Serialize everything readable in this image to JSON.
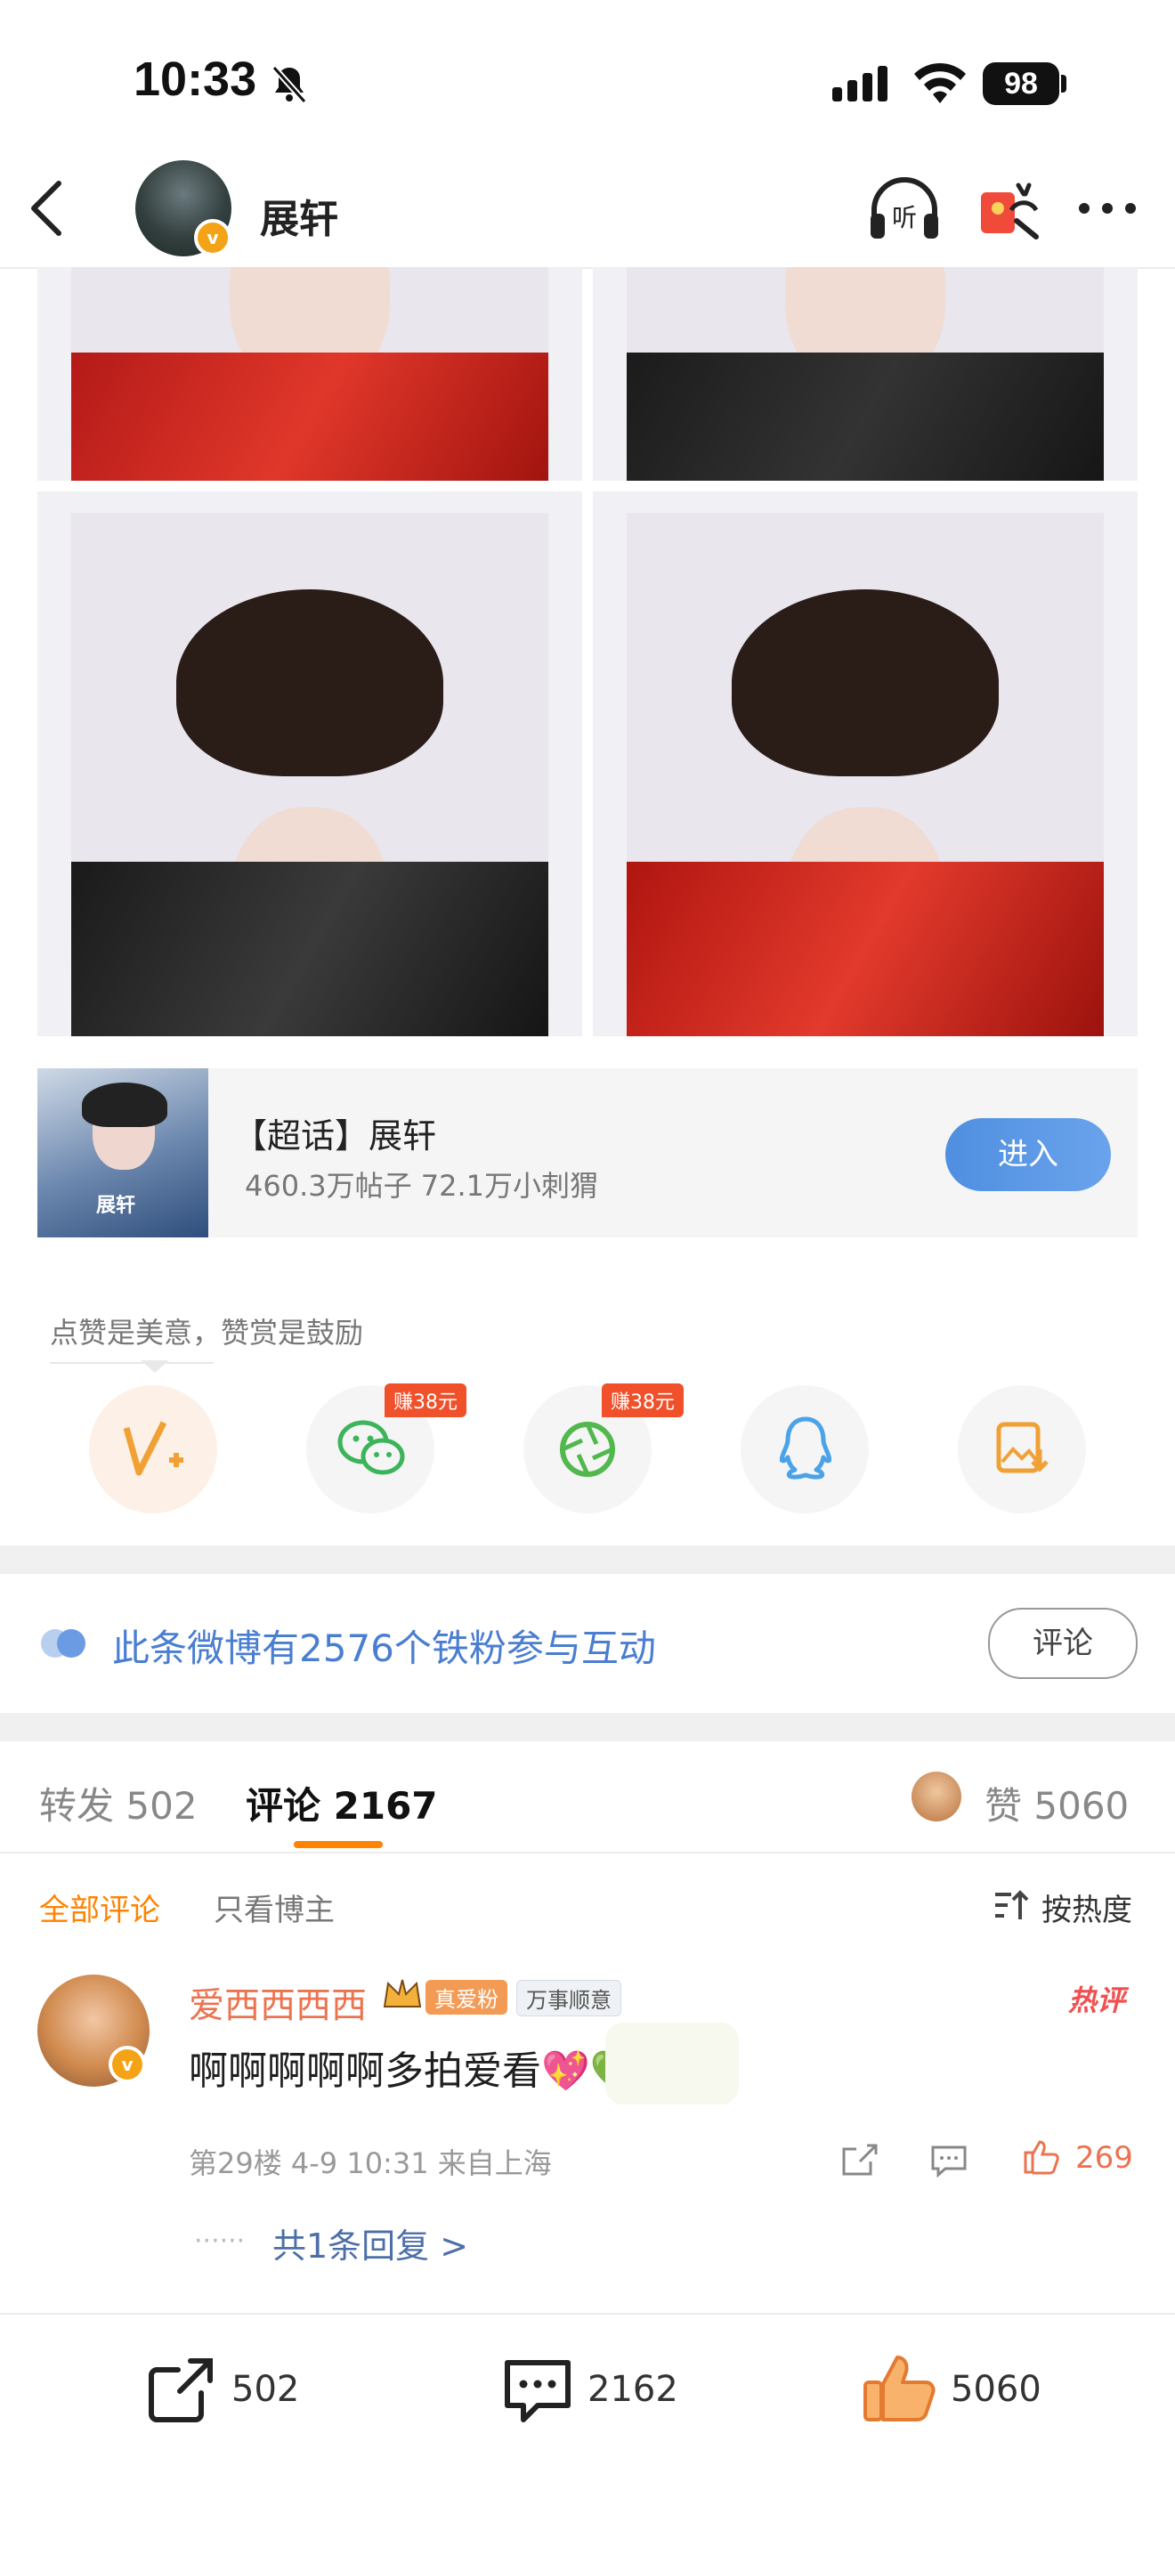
{
  "status_bar": {
    "time": "10:33",
    "battery": "98"
  },
  "header": {
    "user_name": "展轩"
  },
  "super_topic": {
    "title": "【超话】展轩",
    "stats": "460.3万帖子 72.1万小刺猬",
    "enter_label": "进入",
    "thumb_name": "展轩"
  },
  "reward_tip": "点赞是美意，赞赏是鼓励",
  "share": {
    "reward_tag_1": "赚38元",
    "reward_tag_2": "赚38元"
  },
  "fans_banner": {
    "text": "此条微博有2576个铁粉参与互动",
    "comment_label": "评论"
  },
  "tabs": {
    "repost_label": "转发",
    "repost_count": "502",
    "comment_label": "评论",
    "comment_count": "2167",
    "like_label": "赞",
    "like_count": "5060"
  },
  "filters": {
    "all": "全部评论",
    "author_only": "只看博主",
    "sort": "按热度"
  },
  "comment": {
    "user": "爱西西西西",
    "fan_badge": "真爱粉",
    "wish_badge": "万事顺意",
    "hot_label": "热评",
    "text": "啊啊啊啊啊多拍爱看💖💚",
    "meta": "第29楼 4-9 10:31 来自上海",
    "likes": "269",
    "reply_dots": "······",
    "reply_link": "共1条回复 >"
  },
  "bottom_bar": {
    "reposts": "502",
    "comments": "2162",
    "likes": "5060"
  },
  "colors": {
    "accent": "#ff8200",
    "link_blue": "#4a7ed1",
    "like_orange": "#eb7350",
    "enter_blue": "#5b98e6"
  }
}
